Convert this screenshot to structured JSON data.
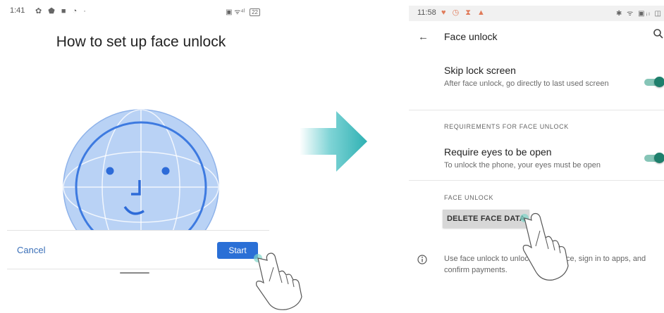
{
  "left": {
    "status_bar": {
      "time": "1:41",
      "icons": "✿ ⬟ ■ ◔ ·",
      "right_icons": "▣ ᯤ⁴ˡ",
      "battery": "22"
    },
    "title": "How to set up face unlock",
    "cancel_label": "Cancel",
    "start_label": "Start"
  },
  "right": {
    "status_bar": {
      "time": "11:58",
      "icons": "♥ ◷ ⧗ ▲",
      "right_icons": "✱ ᯤ ▣ᵢₗ ◫"
    },
    "app_title": "Face unlock",
    "skip_lock": {
      "title": "Skip lock screen",
      "summary": "After face unlock, go directly to last used screen",
      "enabled": true
    },
    "requirements_header": "REQUIREMENTS FOR FACE UNLOCK",
    "require_eyes": {
      "title": "Require eyes to be open",
      "summary": "To unlock the phone, your eyes must be open",
      "enabled": true
    },
    "face_unlock_header": "FACE UNLOCK",
    "delete_label": "DELETE FACE DATA",
    "info_text": "Use face unlock to unlock your device, sign in to apps, and confirm payments."
  },
  "colors": {
    "accent_blue": "#2a6fd6",
    "toggle_green": "#1e7f6c",
    "arrow_teal": "#38b6b8",
    "face_blue": "#a9c8f2"
  }
}
